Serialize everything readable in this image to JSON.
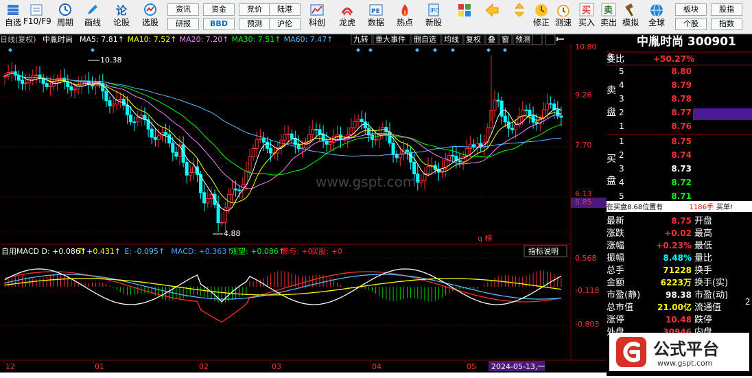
{
  "toolbar": {
    "left_items": [
      {
        "icon": "grid-icon",
        "label": "自选"
      },
      {
        "icon": "f10-icon",
        "label": "F10/F9"
      },
      {
        "icon": "clock-icon",
        "label": "周期"
      },
      {
        "icon": "pencil-icon",
        "label": "画线"
      },
      {
        "icon": "forum-icon",
        "label": "论股"
      },
      {
        "icon": "radar-icon",
        "label": "选股"
      }
    ],
    "small_buttons_top": [
      "资讯",
      "资金",
      "竞价",
      "陆港"
    ],
    "small_buttons_bottom": [
      "研报",
      "BBD",
      "预测",
      "沪伦"
    ],
    "mid_items": [
      {
        "icon": "tech-chart-icon",
        "label": "科创"
      },
      {
        "icon": "dragon-tiger-icon",
        "label": "龙虎"
      },
      {
        "icon": "pe-data-icon",
        "label": "数据"
      },
      {
        "icon": "hotspot-icon",
        "label": "热点"
      },
      {
        "icon": "new-stock-icon",
        "label": "新股"
      }
    ],
    "right_items": [
      {
        "icon": "color-palette-icon",
        "label": ""
      },
      {
        "icon": "back-arrow-icon",
        "label": ""
      },
      {
        "icon": "up-down-arrows-icon",
        "label": ""
      },
      {
        "icon": "revise-icon",
        "label": "修正"
      },
      {
        "icon": "stopwatch-icon",
        "label": "测速"
      },
      {
        "icon": "buy-icon",
        "label": "买入",
        "glyph": "买"
      },
      {
        "icon": "sell-icon",
        "label": "卖出",
        "glyph": "卖"
      },
      {
        "icon": "gavel-icon",
        "label": "模拟"
      },
      {
        "icon": "globe-icon",
        "label": "全球"
      }
    ],
    "right_buttons_top": [
      "板块",
      "股指"
    ],
    "right_buttons_bottom": [
      "个股",
      "指数"
    ]
  },
  "chart_header": {
    "period": "日线(复权)",
    "stock_name": "中胤时尚",
    "ma_labels": [
      {
        "text": "MA5: 7.81",
        "color": "#ffffff"
      },
      {
        "text": "MA10: 7.52",
        "color": "#ffff00"
      },
      {
        "text": "MA20: 7.20",
        "color": "#ff80ff"
      },
      {
        "text": "MA30: 7.51",
        "color": "#00ff00"
      },
      {
        "text": "MA60: 7.47",
        "color": "#55bbff"
      }
    ],
    "tabs": [
      "九转",
      "重大事件",
      "删自选",
      "均线",
      "复权",
      "叠",
      "窗",
      "预测"
    ]
  },
  "price_axis": [
    "10.80",
    "9.26",
    "7.70",
    "6.13",
    "5.85"
  ],
  "annotations": {
    "high": "10.38",
    "low": "4.88",
    "q_label": "q 榜"
  },
  "watermark": "www.gspt.com",
  "macd": {
    "header": "自用MACD D: +0.086↑ T: +0.431↑ E: -0.095↑ MACD: +0.363↑ 观望: +0.086↑ 参与: +0 买股: +0",
    "header_parts": [
      {
        "text": "自用MACD D: +0.086↑",
        "color": "#ffffff"
      },
      {
        "text": "T: +0.431↑",
        "color": "#ffff00"
      },
      {
        "text": "E: -0.095↑",
        "color": "#55bbff"
      },
      {
        "text": "MACD: +0.363↑",
        "color": "#5599ff"
      },
      {
        "text": "观望: +0.086↑",
        "color": "#00ff00"
      },
      {
        "text": "参与: +0",
        "color": "#ff3030"
      },
      {
        "text": "买股: +0",
        "color": "#ff3030"
      }
    ],
    "indicator_btn": "指标说明",
    "axis": [
      "0.568",
      "-0.118",
      "-0.803"
    ]
  },
  "date_axis": [
    "12",
    "01",
    "02",
    "03",
    "04",
    "05"
  ],
  "date_cursor": "2024-05-13,一",
  "sidebar": {
    "title": "中胤时尚 300901",
    "r_label": "R",
    "weibi": {
      "label": "委比",
      "value": "+50.27%"
    },
    "sell_label": "卖盘",
    "buy_label": "买盘",
    "sells": [
      {
        "n": "5",
        "price": "8.80"
      },
      {
        "n": "4",
        "price": "8.79"
      },
      {
        "n": "3",
        "price": "8.78"
      },
      {
        "n": "2",
        "price": "8.77"
      },
      {
        "n": "1",
        "price": "8.76"
      }
    ],
    "buys": [
      {
        "n": "1",
        "price": "8.75"
      },
      {
        "n": "2",
        "price": "8.74"
      },
      {
        "n": "3",
        "price": "8.73"
      },
      {
        "n": "4",
        "price": "8.72"
      },
      {
        "n": "5",
        "price": "8.71"
      }
    ],
    "status_text": "在买盘8.68位置有",
    "status_qty": "1186手",
    "status_action": "买单!",
    "stats": [
      {
        "k": "最新",
        "v": "8.75",
        "c": "#ff3030",
        "k2": "开盘"
      },
      {
        "k": "涨跌",
        "v": "+0.02",
        "c": "#ff3030",
        "k2": "最高"
      },
      {
        "k": "涨幅",
        "v": "+0.23%",
        "c": "#ff3030",
        "k2": "最低"
      },
      {
        "k": "振幅",
        "v": "8.48%",
        "c": "#00ffff",
        "k2": "量比"
      },
      {
        "k": "总手",
        "v": "71228",
        "c": "#ffff00",
        "k2": "换手"
      },
      {
        "k": "金额",
        "v": "6223万",
        "c": "#ffff00",
        "k2": "换手(实)"
      },
      {
        "k": "市盈(静)",
        "v": "98.38",
        "c": "#ffffff",
        "k2": "市盈(动)"
      },
      {
        "k": "总市值",
        "v": "21.00亿",
        "c": "#ffff00",
        "k2": "流通值"
      },
      {
        "k": "涨停",
        "v": "10.48",
        "c": "#ff3030",
        "k2": "跌停"
      },
      {
        "k": "外盘",
        "v": "30946",
        "c": "#ff3030",
        "k2": "内盘"
      }
    ],
    "stats_right_value": "2"
  },
  "logo": {
    "text": "公式平台",
    "url": "www.gspt.com"
  }
}
